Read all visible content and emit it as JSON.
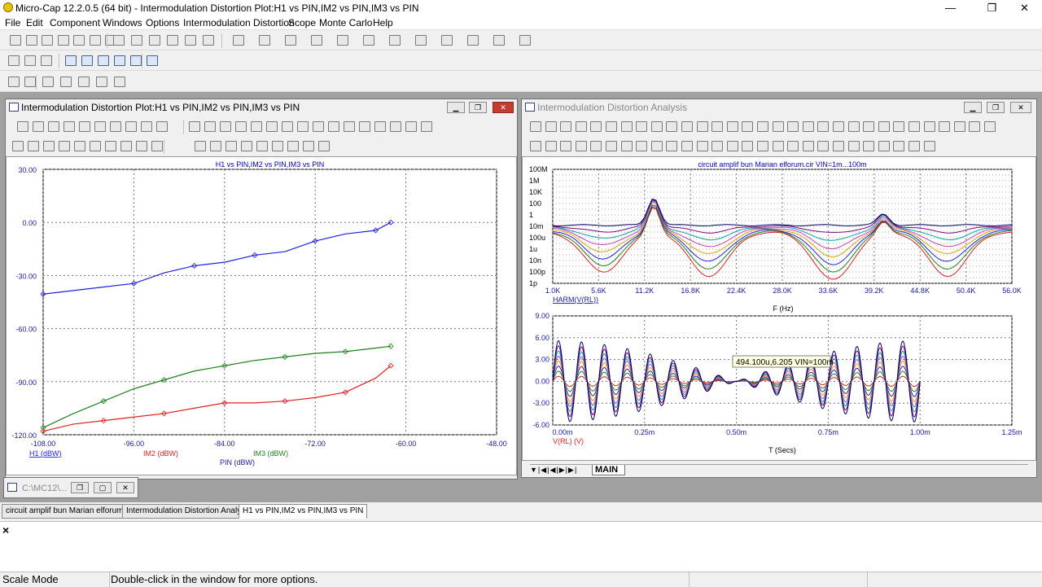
{
  "app": {
    "title": "Micro-Cap 12.2.0.5 (64 bit) - Intermodulation Distortion Plot:H1 vs PIN,IM2 vs PIN,IM3 vs PIN",
    "minimize": "—",
    "maximize": "❐",
    "close": "✕"
  },
  "menu": [
    "File",
    "Edit",
    "Component",
    "Windows",
    "Options",
    "Intermodulation Distortion",
    "Scope",
    "Monte Carlo",
    "Help"
  ],
  "left_window": {
    "title": "Intermodulation Distortion Plot:H1 vs PIN,IM2 vs PIN,IM3 vs PIN"
  },
  "right_window": {
    "title": "Intermodulation Distortion Analysis",
    "tab_label": "MAIN"
  },
  "minimized_window": {
    "title": "C:\\MC12\\..."
  },
  "doc_tabs": [
    "circuit amplif bun Marian elforum.cir",
    "Intermodulation Distortion Analysis",
    "H1 vs PIN,IM2 vs PIN,IM3 vs PIN"
  ],
  "command_pane": {
    "close": "×"
  },
  "status": {
    "mode": "Scale Mode",
    "message": "Double-click in the window for more options."
  },
  "colors": {
    "h1": "#2020e0",
    "im2": "#e02020",
    "im3": "#208020",
    "title_blue": "#0000c0"
  },
  "chart_data": [
    {
      "type": "line",
      "title": "H1 vs PIN,IM2 vs PIN,IM3 vs PIN",
      "xlabel": "PIN (dBW)",
      "xlim": [
        -108,
        -48
      ],
      "ylim": [
        -120,
        30
      ],
      "x_ticks": [
        "-108.00",
        "-96.00",
        "-84.00",
        "-72.00",
        "-60.00",
        "-48.00"
      ],
      "y_ticks": [
        "30.00",
        "0.00",
        "-30.00",
        "-60.00",
        "-90.00",
        "-120.00"
      ],
      "grid": true,
      "series": [
        {
          "name": "H1 (dBW)",
          "color": "#2020e0",
          "x": [
            -108,
            -100,
            -96,
            -92,
            -88,
            -84,
            -80,
            -76,
            -72,
            -68,
            -64,
            -62
          ],
          "y": [
            -40.5,
            -36.5,
            -34.5,
            -28.5,
            -24.5,
            -22.5,
            -18.5,
            -16.5,
            -10.5,
            -6.5,
            -4.5,
            0
          ]
        },
        {
          "name": "IM2 (dBW)",
          "color": "#e02020",
          "x": [
            -108,
            -104,
            -100,
            -96,
            -92,
            -88,
            -84,
            -80,
            -76,
            -72,
            -68,
            -64,
            -62
          ],
          "y": [
            -118,
            -114,
            -112,
            -110,
            -108,
            -105,
            -102,
            -102,
            -101,
            -99,
            -96,
            -88,
            -81
          ]
        },
        {
          "name": "IM3 (dBW)",
          "color": "#208020",
          "x": [
            -108,
            -104,
            -100,
            -96,
            -92,
            -88,
            -84,
            -80,
            -76,
            -72,
            -68,
            -64,
            -62
          ],
          "y": [
            -116,
            -108,
            -101,
            -94,
            -89,
            -84,
            -81,
            -78,
            -76,
            -74,
            -73,
            -71,
            -70
          ]
        }
      ]
    },
    {
      "type": "line",
      "title": "circuit amplif bun Marian elforum.cir VIN=1m...100m",
      "xlabel": "F (Hz)",
      "ylabel": "HARM(V(RL))",
      "x_ticks": [
        "1.0K",
        "5.6K",
        "11.2K",
        "16.8K",
        "22.4K",
        "28.0K",
        "33.6K",
        "39.2K",
        "44.8K",
        "50.4K",
        "56.0K"
      ],
      "y_ticks": [
        "100M",
        "1M",
        "10K",
        "100",
        "1",
        "10m",
        "100u",
        "1u",
        "10n",
        "100p",
        "1p"
      ],
      "xlim": [
        1000,
        56000
      ],
      "log_y": true,
      "grid": true
    },
    {
      "type": "line",
      "title": "",
      "xlabel": "T (Secs)",
      "ylabel": "V(RL) (V)",
      "x_ticks": [
        "0.00m",
        "0.25m",
        "0.50m",
        "0.75m",
        "1.00m",
        "1.25m"
      ],
      "y_ticks": [
        "9.00",
        "6.00",
        "3.00",
        "0.00",
        "-3.00",
        "-6.00"
      ],
      "xlim": [
        0,
        1.25
      ],
      "ylim": [
        -6,
        9
      ],
      "grid": true,
      "annotation": "494.100u,6.205 VIN=100m"
    }
  ]
}
